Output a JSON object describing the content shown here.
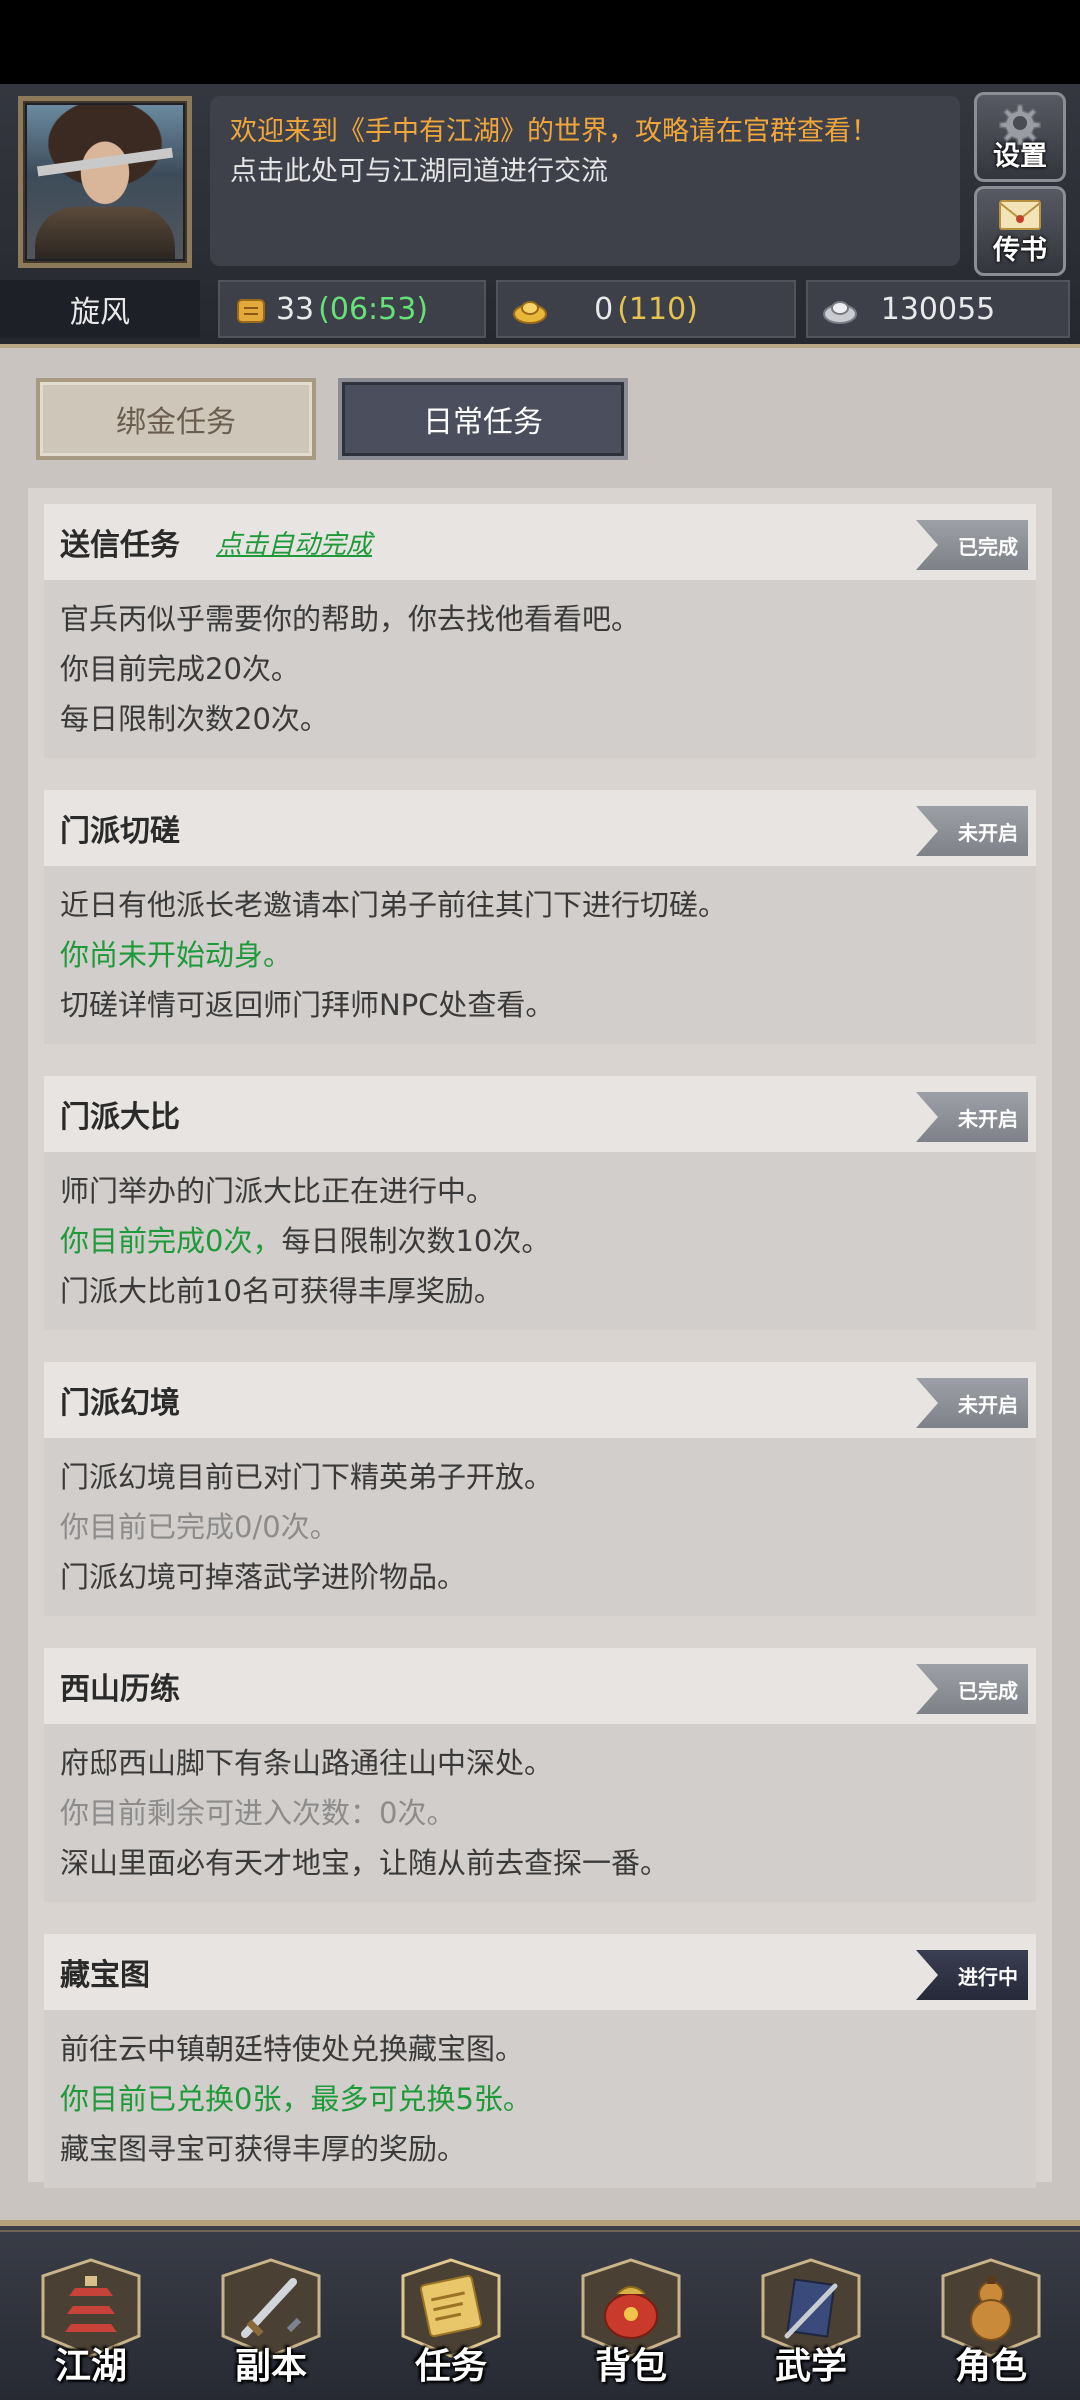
{
  "header": {
    "welcome_line": "欢迎来到《手中有江湖》的世界，攻略请在官群查看！",
    "chat_hint": "点击此处可与江湖同道进行交流",
    "settings_label": "设置",
    "mail_label": "传书",
    "player_name": "旋风",
    "stamina": {
      "value": "33",
      "timer": "(06:53)"
    },
    "gold": {
      "value": "0",
      "extra": "(110)"
    },
    "silver": {
      "value": "130055"
    }
  },
  "tabs": [
    {
      "label": "绑金任务",
      "active": false
    },
    {
      "label": "日常任务",
      "active": true
    }
  ],
  "tasks": [
    {
      "title": "送信任务",
      "link": "点击自动完成",
      "status": "已完成",
      "lines": [
        "官兵丙似乎需要你的帮助，你去找他看看吧。",
        "你目前完成20次。",
        "每日限制次数20次。"
      ]
    },
    {
      "title": "门派切磋",
      "status": "未开启",
      "lines": [
        "近日有他派长老邀请本门弟子前往其门下进行切磋。",
        "你尚未开始动身。",
        "切磋详情可返回师门拜师NPC处查看。"
      ]
    },
    {
      "title": "门派大比",
      "status": "未开启",
      "lines": [
        "师门举办的门派大比正在进行中。",
        "你目前完成0次，",
        "每日限制次数10次。",
        "门派大比前10名可获得丰厚奖励。"
      ]
    },
    {
      "title": "门派幻境",
      "status": "未开启",
      "lines": [
        "门派幻境目前已对门下精英弟子开放。",
        "你目前已完成0/0次。",
        "门派幻境可掉落武学进阶物品。"
      ]
    },
    {
      "title": "西山历练",
      "status": "已完成",
      "lines": [
        "府邸西山脚下有条山路通往山中深处。",
        "你目前剩余可进入次数：0次。",
        "深山里面必有天才地宝，让随从前去查探一番。"
      ]
    },
    {
      "title": "藏宝图",
      "status": "进行中",
      "lines": [
        "前往云中镇朝廷特使处兑换藏宝图。",
        "你目前已兑换0张，最多可兑换5张。",
        "藏宝图寻宝可获得丰厚的奖励。"
      ]
    }
  ],
  "nav": [
    {
      "label": "江湖",
      "icon": "pagoda-icon"
    },
    {
      "label": "副本",
      "icon": "sword-icon"
    },
    {
      "label": "任务",
      "icon": "scroll-icon"
    },
    {
      "label": "背包",
      "icon": "bag-icon"
    },
    {
      "label": "武学",
      "icon": "book-icon"
    },
    {
      "label": "角色",
      "icon": "gourd-icon"
    }
  ],
  "colors": {
    "accent_orange": "#f0a63a",
    "green_text": "#1f9a3a",
    "timer_green": "#67e07a",
    "gold_yellow": "#e6c24e",
    "status_gray": "#8c8f96",
    "status_dark": "#2e3244"
  }
}
